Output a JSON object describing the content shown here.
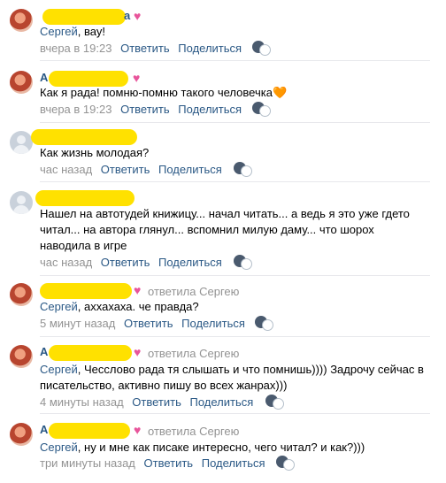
{
  "comments": [
    {
      "mention": "Сергей",
      "text": ", вау!",
      "time": "вчера в 19:23",
      "reply": "Ответить",
      "share": "Поделиться"
    },
    {
      "text": "Как я рада! помню-помню такого человечка",
      "emoji": "🧡",
      "time": "вчера в 19:23",
      "reply": "Ответить",
      "share": "Поделиться"
    },
    {
      "text": "Как жизнь молодая?",
      "time": "час назад",
      "reply": "Ответить",
      "share": "Поделиться"
    },
    {
      "lines": [
        "Нашел на автотудей книжицу... начал читать... а ведь я это уже гдето",
        "читал... на автора глянул... вспомнил милую даму... что шорох",
        "наводила в игре"
      ],
      "time": "час назад",
      "reply": "Ответить",
      "share": "Поделиться"
    },
    {
      "replied": "ответила Сергею",
      "mention": "Сергей",
      "text": ", аххахаха. че правда?",
      "time": "5 минут назад",
      "reply": "Ответить",
      "share": "Поделиться"
    },
    {
      "replied": "ответила Сергею",
      "mention": "Сергей",
      "text": ", Чесслово рада тя слышать и что помнишь)))) Задрочу сейчас в",
      "line2": "писательство, активно пишу во всех жанрах)))",
      "time": "4 минуты назад",
      "reply": "Ответить",
      "share": "Поделиться"
    },
    {
      "replied": "ответила Сергею",
      "mention": "Сергей",
      "text": ", ну и мне как писаке интересно, чего читал? и как?)))",
      "time": "три минуты назад",
      "reply": "Ответить",
      "share": "Поделиться"
    }
  ],
  "letter_a": "А",
  "letter_a_small": "а"
}
